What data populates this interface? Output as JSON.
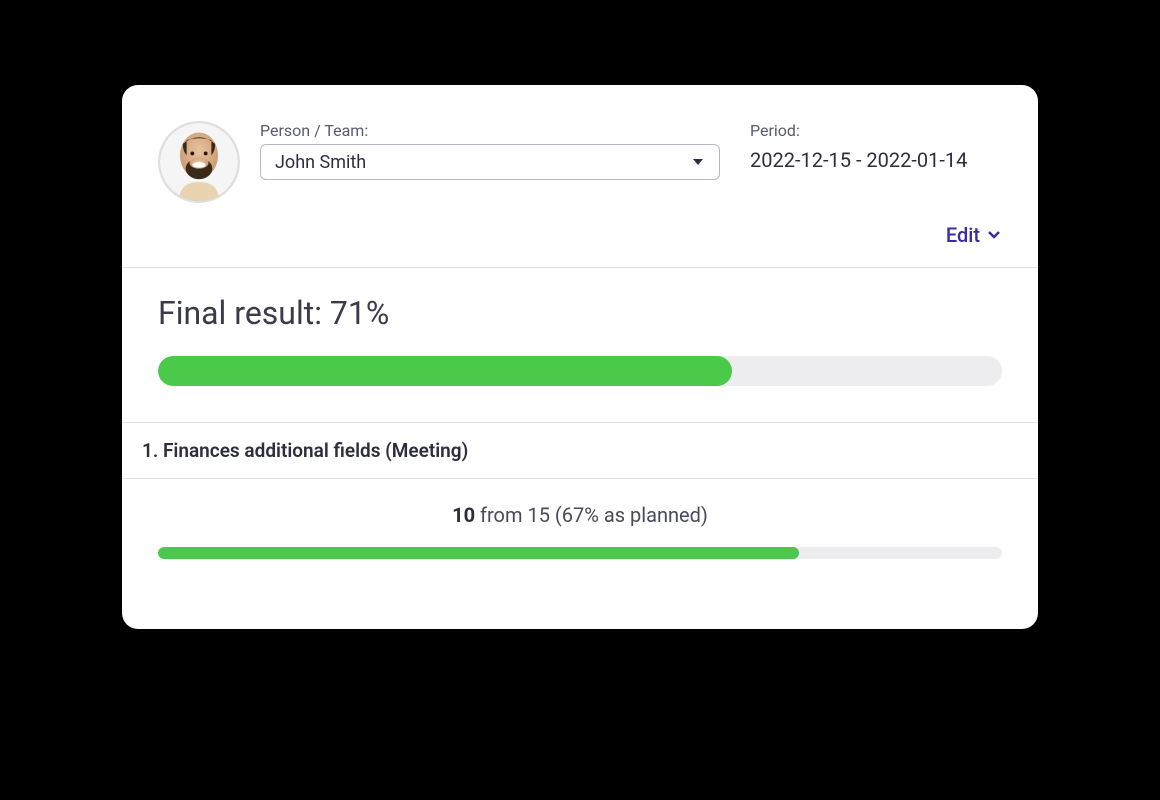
{
  "header": {
    "person_label": "Person / Team:",
    "person_value": "John Smith",
    "period_label": "Period:",
    "period_value": "2022-12-15 - 2022-01-14"
  },
  "actions": {
    "edit_label": "Edit"
  },
  "result": {
    "final_result_label": "Final result: 71%",
    "final_percent": 68
  },
  "subsection": {
    "title": "1. Finances additional fields (Meeting)",
    "detail_value": "10",
    "detail_rest": " from 15 (67% as planned)",
    "detail_percent": 76
  },
  "colors": {
    "accent": "#4ac94a",
    "link": "#3a2e9e"
  }
}
